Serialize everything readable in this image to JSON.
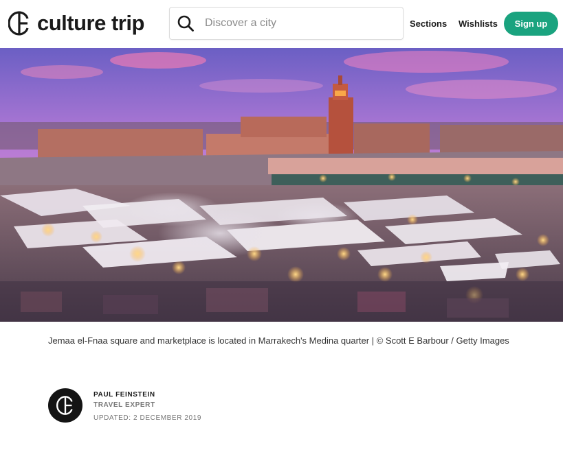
{
  "brand": {
    "name": "culture trip",
    "logo_icon": "culture-trip-logo-icon",
    "accent": "#1aa37f"
  },
  "search": {
    "placeholder": "Discover a city",
    "value": "",
    "icon": "search-icon"
  },
  "nav": {
    "sections_label": "Sections",
    "wishlists_label": "Wishlists",
    "signup_label": "Sign up"
  },
  "hero": {
    "caption": "Jemaa el-Fnaa square and marketplace is located in Marrakech's Medina quarter | © Scott E Barbour / Getty Images"
  },
  "author": {
    "name": "PAUL FEINSTEIN",
    "role": "TRAVEL EXPERT",
    "updated": "UPDATED: 2 DECEMBER 2019"
  }
}
